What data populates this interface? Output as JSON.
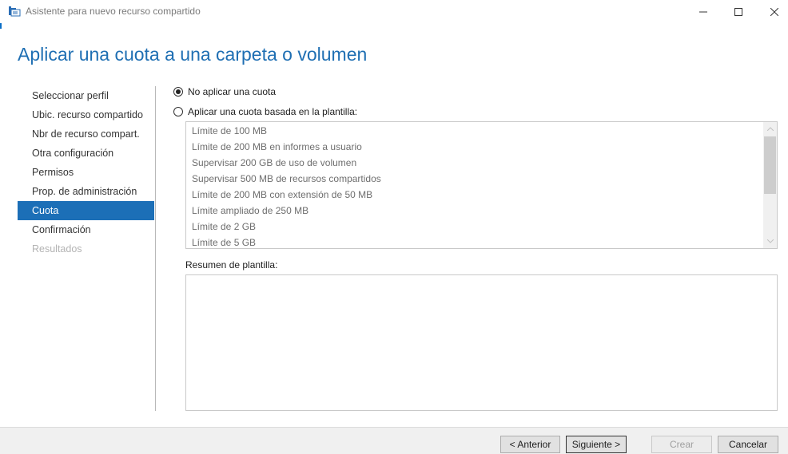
{
  "window": {
    "title": "Asistente para nuevo recurso compartido",
    "accent_color": "#1c6fb7"
  },
  "header": {
    "title": "Aplicar una cuota a una carpeta o volumen"
  },
  "nav": {
    "items": [
      {
        "label": "Seleccionar perfil",
        "state": "normal"
      },
      {
        "label": "Ubic. recurso compartido",
        "state": "normal"
      },
      {
        "label": "Nbr de recurso compart.",
        "state": "normal"
      },
      {
        "label": "Otra configuración",
        "state": "normal"
      },
      {
        "label": "Permisos",
        "state": "normal"
      },
      {
        "label": "Prop. de administración",
        "state": "normal"
      },
      {
        "label": "Cuota",
        "state": "active"
      },
      {
        "label": "Confirmación",
        "state": "normal"
      },
      {
        "label": "Resultados",
        "state": "disabled"
      }
    ]
  },
  "quota": {
    "option_none": {
      "label": "No aplicar una cuota",
      "selected": true
    },
    "option_template": {
      "label": "Aplicar una cuota basada en la plantilla:",
      "selected": false
    },
    "templates": [
      "Límite de 100 MB",
      "Límite de 200 MB en informes a usuario",
      "Supervisar 200 GB de uso de volumen",
      "Supervisar 500 MB de recursos compartidos",
      "Límite de 200 MB con extensión de 50 MB",
      "Límite ampliado de 250 MB",
      "Límite de 2 GB",
      "Límite de 5 GB"
    ],
    "summary_label": "Resumen de plantilla:",
    "summary_text": ""
  },
  "footer": {
    "prev_label": "< Anterior",
    "next_label": "Siguiente >",
    "create_label": "Crear",
    "cancel_label": "Cancelar"
  }
}
